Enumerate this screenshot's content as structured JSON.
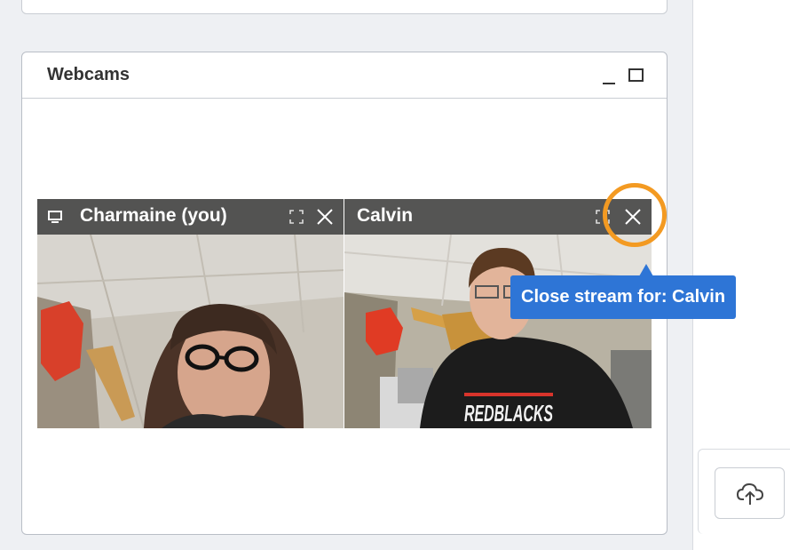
{
  "webcams_panel": {
    "title": "Webcams",
    "controls": {
      "minimize_icon": "minimize-icon",
      "maximize_icon": "maximize-icon"
    }
  },
  "streams": [
    {
      "name": "Charmaine (you)",
      "icons": [
        "presenter-screen-icon",
        "fullscreen-icon",
        "close-icon"
      ]
    },
    {
      "name": "Calvin",
      "icons": [
        "fullscreen-icon",
        "close-icon"
      ]
    }
  ],
  "tooltip": {
    "text": "Close stream for: Calvin"
  },
  "highlight_color": "#f39a22",
  "tooltip_color": "#2e75d6",
  "upload": {
    "icon": "cloud-upload-icon"
  }
}
